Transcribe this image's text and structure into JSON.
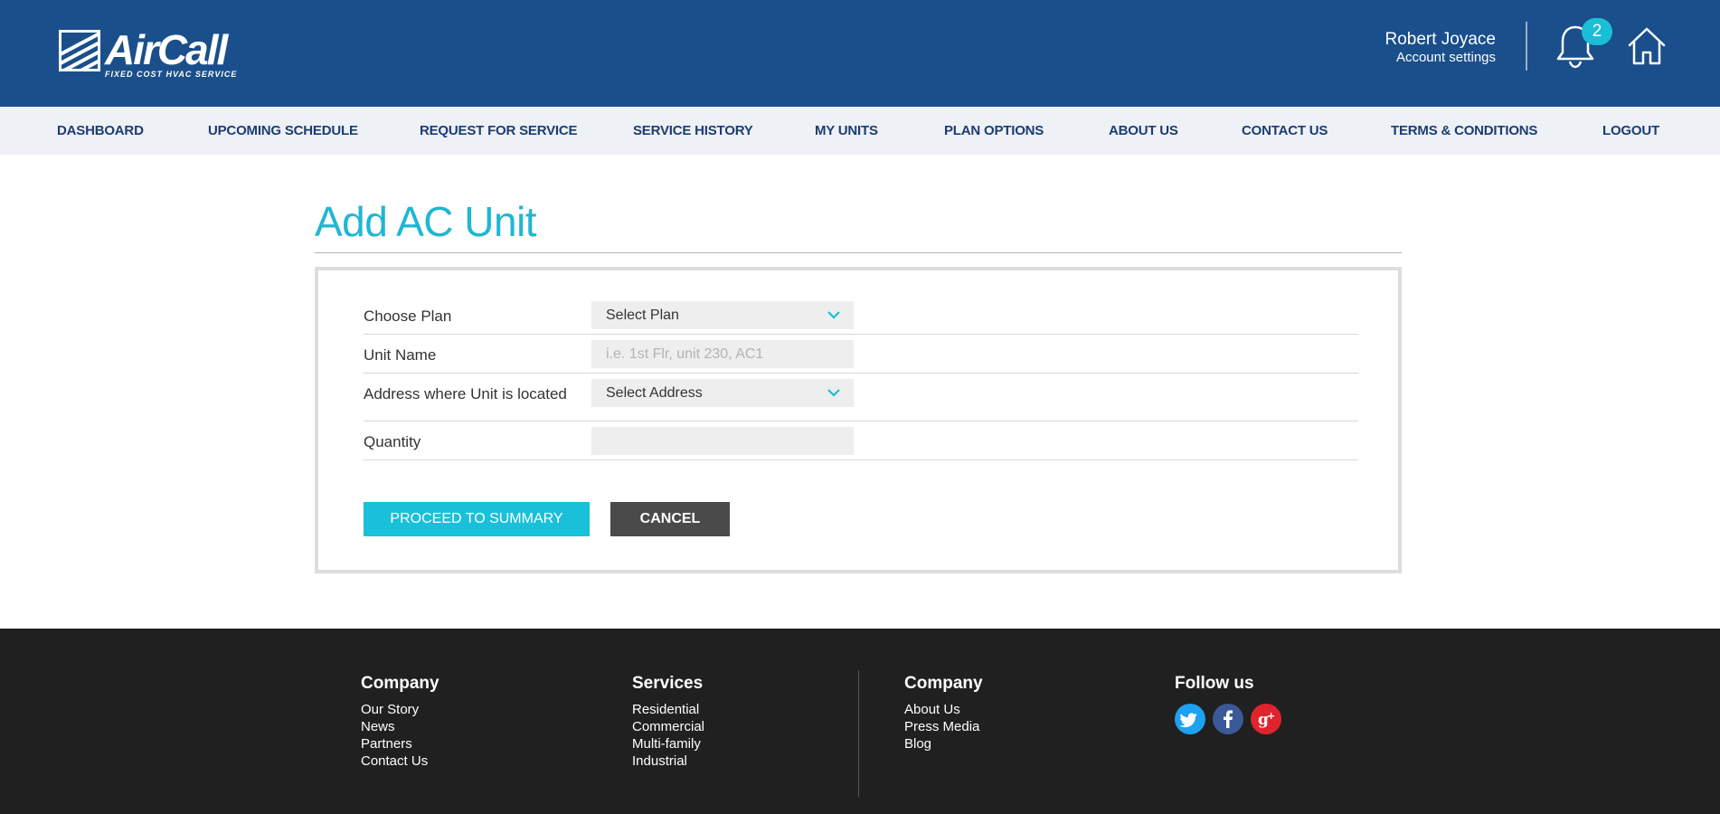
{
  "brand": {
    "name": "AirCall",
    "tagline": "FIXED COST HVAC SERVICE"
  },
  "user": {
    "name": "Robert Joyace",
    "settings_label": "Account settings"
  },
  "notifications": {
    "count": "2"
  },
  "nav": {
    "items": [
      {
        "label": "DASHBOARD"
      },
      {
        "label": "UPCOMING SCHEDULE"
      },
      {
        "label": "REQUEST FOR SERVICE"
      },
      {
        "label": "SERVICE HISTORY"
      },
      {
        "label": "MY UNITS"
      },
      {
        "label": "PLAN OPTIONS"
      },
      {
        "label": "ABOUT US"
      },
      {
        "label": "CONTACT US"
      },
      {
        "label": "TERMS & CONDITIONS"
      },
      {
        "label": "LOGOUT"
      }
    ]
  },
  "page": {
    "title": "Add AC Unit"
  },
  "form": {
    "plan": {
      "label": "Choose Plan",
      "value": "Select Plan"
    },
    "unit_name": {
      "label": "Unit Name",
      "placeholder": "i.e. 1st Flr, unit 230, AC1"
    },
    "address": {
      "label": "Address where Unit is located",
      "value": "Select Address"
    },
    "quantity": {
      "label": "Quantity",
      "value": ""
    },
    "proceed_label": "PROCEED TO SUMMARY",
    "cancel_label": "CANCEL"
  },
  "footer": {
    "company": {
      "heading": "Company",
      "links": [
        "Our Story",
        "News",
        "Partners",
        "Contact Us"
      ]
    },
    "services": {
      "heading": "Services",
      "links": [
        "Residential",
        "Commercial",
        "Multi-family",
        "Industrial"
      ]
    },
    "company2": {
      "heading": "Company",
      "links": [
        "About Us",
        "Press Media",
        "Blog"
      ]
    },
    "follow": {
      "heading": "Follow us"
    }
  },
  "colors": {
    "header_bg": "#1a4f8b",
    "accent": "#19c0d9",
    "nav_text": "#1b3d72",
    "footer_bg": "#202020",
    "twitter": "#1da1f2",
    "facebook": "#3b5998",
    "google_plus": "#e0242e"
  }
}
